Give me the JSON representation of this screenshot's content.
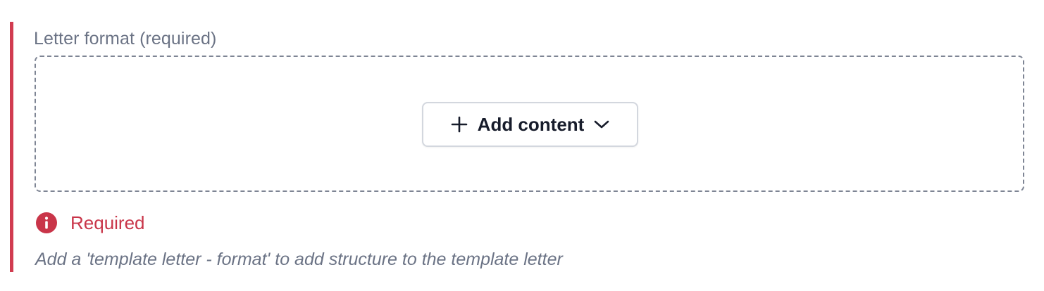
{
  "field": {
    "label": "Letter format (required)",
    "add_button": {
      "label": "Add content",
      "leading_icon": "plus-icon",
      "trailing_icon": "chevron-down-icon"
    },
    "error": {
      "icon": "alert-circle-icon",
      "text": "Required",
      "color": "#c93549"
    },
    "help_text": "Add a 'template letter - format' to add structure to the template letter",
    "accent_color": "#d13c50"
  }
}
